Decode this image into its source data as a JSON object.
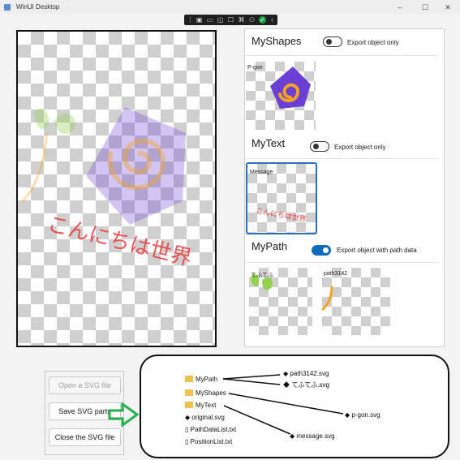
{
  "window": {
    "title": "WinUI Desktop",
    "min": "–",
    "max": "☐",
    "close": "✕"
  },
  "canvas_text": "こんにちは世界",
  "panel": {
    "shapes": {
      "title": "MyShapes",
      "toggle_label": "Export object only",
      "toggle_on": false,
      "thumb_label": "P-gon"
    },
    "text": {
      "title": "MyText",
      "toggle_label": "Export object only",
      "toggle_on": false,
      "thumb_label": "Message",
      "thumb_text": "こんにちは世界"
    },
    "path": {
      "title": "MyPath",
      "toggle_label": "Export object with path data",
      "toggle_on": true,
      "thumb_labels": [
        "てふてふ",
        "path3142"
      ]
    }
  },
  "buttons": {
    "open": "Open a SVG file",
    "save": "Save SVG parts",
    "close": "Close the SVG file"
  },
  "files": {
    "folders": [
      "MyPath",
      "MyShapes",
      "MyText"
    ],
    "items": [
      "original.svg",
      "PathDataList.txt",
      "PositionList.txt"
    ],
    "outputs": [
      "path3142.svg",
      "てふてふ.svg",
      "p-gon.svg",
      "message.svg"
    ]
  },
  "colors": {
    "accent": "#0f6cbd",
    "pentagon": "#6b3fd6",
    "spiral": "#f5a21d",
    "text_red": "#ec3a3a",
    "leaf": "#92d14f",
    "arrow": "#23b14d",
    "folder": "#f2c14e"
  }
}
